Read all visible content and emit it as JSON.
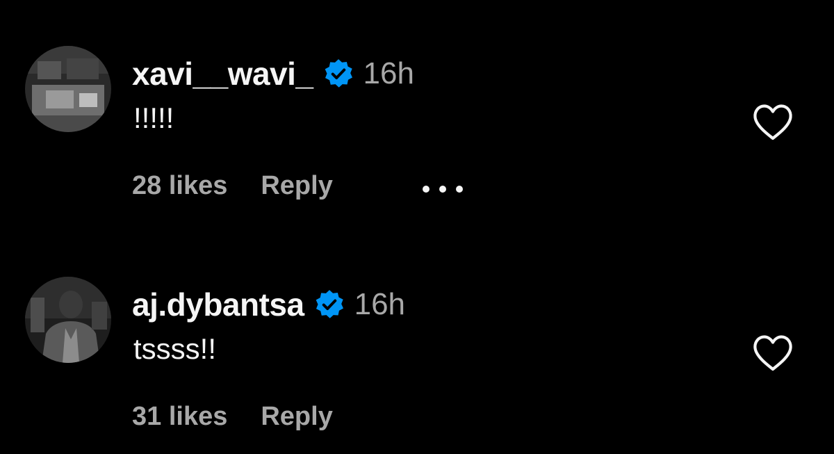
{
  "colors": {
    "background": "#000000",
    "primary_text": "#f5f5f5",
    "secondary_text": "#a8a8a8",
    "verified_badge": "#0095f6"
  },
  "comments": [
    {
      "username": "xavi__wavi_",
      "verified": true,
      "verified_icon": "verified-badge-icon",
      "timestamp": "16h",
      "text": "!!!!!",
      "likes": "28 likes",
      "reply_label": "Reply",
      "has_more_menu": true,
      "more_icon": "more-options-icon",
      "like_icon": "heart-outline-icon"
    },
    {
      "username": "aj.dybantsa",
      "verified": true,
      "verified_icon": "verified-badge-icon",
      "timestamp": "16h",
      "text": "tssss!!",
      "likes": "31 likes",
      "reply_label": "Reply",
      "has_more_menu": false,
      "like_icon": "heart-outline-icon"
    }
  ]
}
